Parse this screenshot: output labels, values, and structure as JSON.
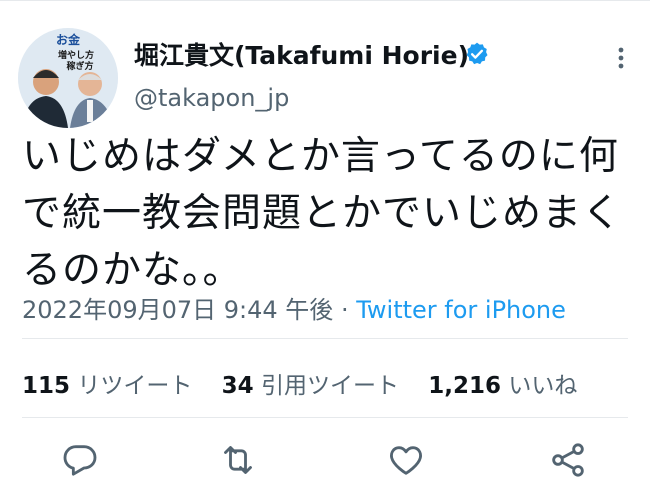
{
  "author": {
    "name": "堀江貴文(Takafumi Horie)",
    "handle": "@takapon_jp",
    "verified": true,
    "avatar_text": [
      "お金",
      "増やし方",
      "稼ぎ方"
    ]
  },
  "tweet": {
    "lines": [
      "いじめはダメとか言ってるのに何",
      "で統一教会問題とかでいじめまく",
      "るのかな。。"
    ],
    "date": "2022年09月07日 9:44 午後",
    "separator": " · ",
    "source": "Twitter for iPhone"
  },
  "stats": {
    "retweets": {
      "count": "115",
      "label": "リツイート"
    },
    "quotes": {
      "count": "34",
      "label": "引用ツイート"
    },
    "likes": {
      "count": "1,216",
      "label": "いいね"
    }
  },
  "actions": [
    "reply-icon",
    "retweet-icon",
    "like-icon",
    "share-icon"
  ],
  "colors": {
    "accent": "#1d9bf0",
    "muted": "#536471",
    "text": "#0f1419"
  }
}
